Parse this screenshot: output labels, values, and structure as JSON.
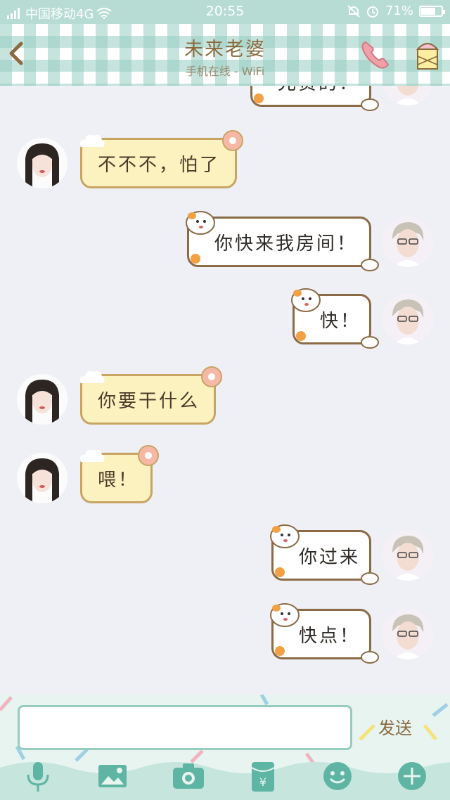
{
  "status_bar": {
    "carrier": "中国移动4G",
    "time": "20:55",
    "battery": "71%",
    "battery_level": 0.71
  },
  "header": {
    "title": "未来老婆",
    "subtitle": "手机在线 - WiFi"
  },
  "messages": [
    {
      "sender": "me",
      "text": "兄贵的！"
    },
    {
      "sender": "her",
      "text": "不不不，怕了"
    },
    {
      "sender": "me",
      "text": "你快来我房间！"
    },
    {
      "sender": "me",
      "text": "快！"
    },
    {
      "sender": "her",
      "text": "你要干什么"
    },
    {
      "sender": "her",
      "text": "喂！"
    },
    {
      "sender": "me",
      "text": "你过来"
    },
    {
      "sender": "me",
      "text": "快点！"
    }
  ],
  "input": {
    "value": "",
    "placeholder": "",
    "send_label": "发送"
  },
  "toolbar": {
    "items": [
      "mic-icon",
      "image-icon",
      "camera-icon",
      "red-packet-icon",
      "emoji-icon",
      "plus-icon"
    ]
  },
  "colors": {
    "accent": "#96cdbf",
    "her_bubble": "#fcf2bf",
    "her_border": "#c8a463",
    "me_bubble": "#ffffff",
    "me_border": "#8b6b45",
    "title_text": "#8a6a3e"
  }
}
